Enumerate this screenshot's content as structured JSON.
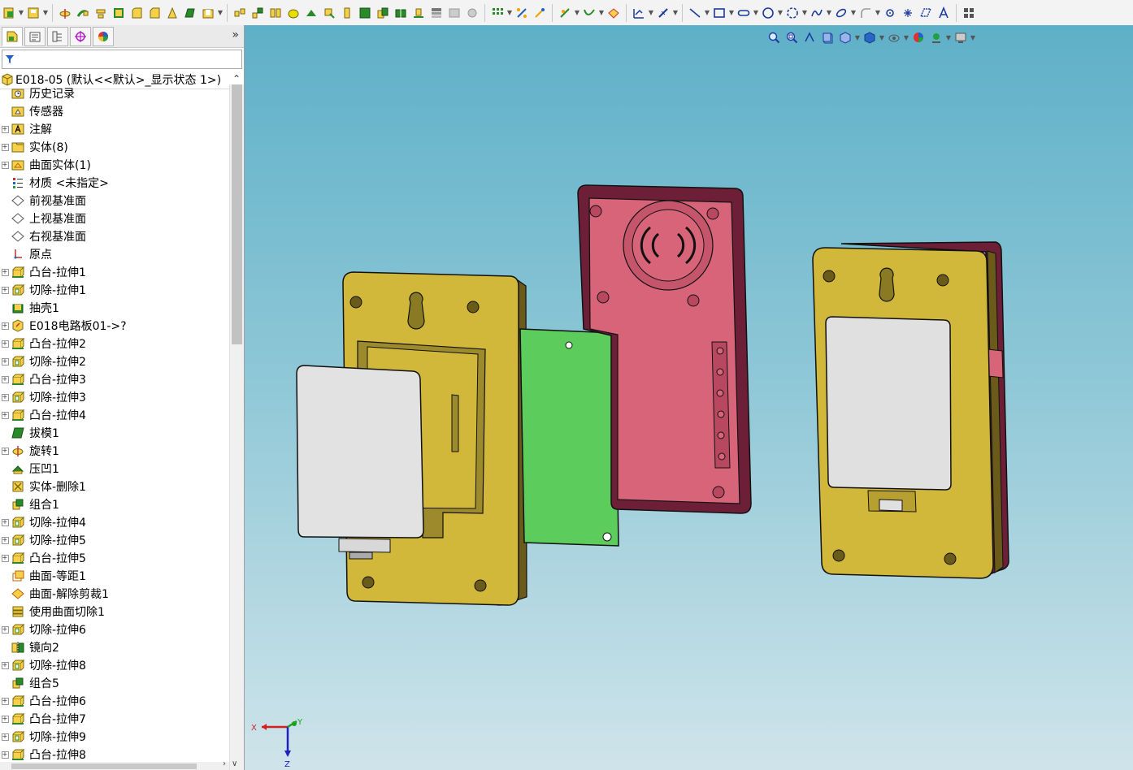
{
  "feature_tree": {
    "root_label": "E018-05  (默认<<默认>_显示状态 1>)",
    "items": [
      {
        "label": "历史记录",
        "icon": "history-folder-icon",
        "expandable": false
      },
      {
        "label": "传感器",
        "icon": "sensor-folder-icon",
        "expandable": false
      },
      {
        "label": "注解",
        "icon": "annotation-icon",
        "expandable": true
      },
      {
        "label": "实体(8)",
        "icon": "solid-bodies-folder-icon",
        "expandable": true
      },
      {
        "label": "曲面实体(1)",
        "icon": "surface-bodies-folder-icon",
        "expandable": true
      },
      {
        "label": "材质 <未指定>",
        "icon": "material-icon",
        "expandable": false
      },
      {
        "label": "前视基准面",
        "icon": "plane-icon",
        "expandable": false
      },
      {
        "label": "上视基准面",
        "icon": "plane-icon",
        "expandable": false
      },
      {
        "label": "右视基准面",
        "icon": "plane-icon",
        "expandable": false
      },
      {
        "label": "原点",
        "icon": "origin-icon",
        "expandable": false
      },
      {
        "label": "凸台-拉伸1",
        "icon": "boss-extrude-icon",
        "expandable": true
      },
      {
        "label": "切除-拉伸1",
        "icon": "cut-extrude-icon",
        "expandable": true
      },
      {
        "label": "抽壳1",
        "icon": "shell-icon",
        "expandable": false
      },
      {
        "label": "E018电路板01->?",
        "icon": "derived-part-icon",
        "expandable": true
      },
      {
        "label": "凸台-拉伸2",
        "icon": "boss-extrude-icon",
        "expandable": true
      },
      {
        "label": "切除-拉伸2",
        "icon": "cut-extrude-icon",
        "expandable": true
      },
      {
        "label": "凸台-拉伸3",
        "icon": "boss-extrude-icon",
        "expandable": true
      },
      {
        "label": "切除-拉伸3",
        "icon": "cut-extrude-icon",
        "expandable": true
      },
      {
        "label": "凸台-拉伸4",
        "icon": "boss-extrude-icon",
        "expandable": true
      },
      {
        "label": "拔模1",
        "icon": "draft-icon",
        "expandable": false
      },
      {
        "label": "旋转1",
        "icon": "revolve-icon",
        "expandable": true
      },
      {
        "label": "压凹1",
        "icon": "indent-icon",
        "expandable": false
      },
      {
        "label": "实体-删除1",
        "icon": "delete-body-icon",
        "expandable": false
      },
      {
        "label": "组合1",
        "icon": "combine-icon",
        "expandable": false
      },
      {
        "label": "切除-拉伸4",
        "icon": "cut-extrude-icon",
        "expandable": true
      },
      {
        "label": "切除-拉伸5",
        "icon": "cut-extrude-icon",
        "expandable": true
      },
      {
        "label": "凸台-拉伸5",
        "icon": "boss-extrude-icon",
        "expandable": true
      },
      {
        "label": "曲面-等距1",
        "icon": "offset-surface-icon",
        "expandable": false
      },
      {
        "label": "曲面-解除剪裁1",
        "icon": "untrim-surface-icon",
        "expandable": false
      },
      {
        "label": "使用曲面切除1",
        "icon": "surface-cut-icon",
        "expandable": false
      },
      {
        "label": "切除-拉伸6",
        "icon": "cut-extrude-icon",
        "expandable": true
      },
      {
        "label": "镜向2",
        "icon": "mirror-icon",
        "expandable": false
      },
      {
        "label": "切除-拉伸8",
        "icon": "cut-extrude-icon",
        "expandable": true
      },
      {
        "label": "组合5",
        "icon": "combine-icon",
        "expandable": false
      },
      {
        "label": "凸台-拉伸6",
        "icon": "boss-extrude-icon",
        "expandable": true
      },
      {
        "label": "凸台-拉伸7",
        "icon": "boss-extrude-icon",
        "expandable": true
      },
      {
        "label": "切除-拉伸9",
        "icon": "cut-extrude-icon",
        "expandable": true
      },
      {
        "label": "凸台-拉伸8",
        "icon": "boss-extrude-icon",
        "expandable": true
      }
    ]
  },
  "triad": {
    "x_label": "X",
    "y_label": "Y",
    "z_label": "Z"
  },
  "colors": {
    "housing_yellow": "#d2b83a",
    "housing_pink": "#d8647a",
    "housing_dark": "#6e1f38",
    "pcb_green": "#5ccc5c",
    "cover_white": "#e0e0e0",
    "viewport_top": "#5eb0c8",
    "viewport_bottom": "#cfe4ea"
  }
}
